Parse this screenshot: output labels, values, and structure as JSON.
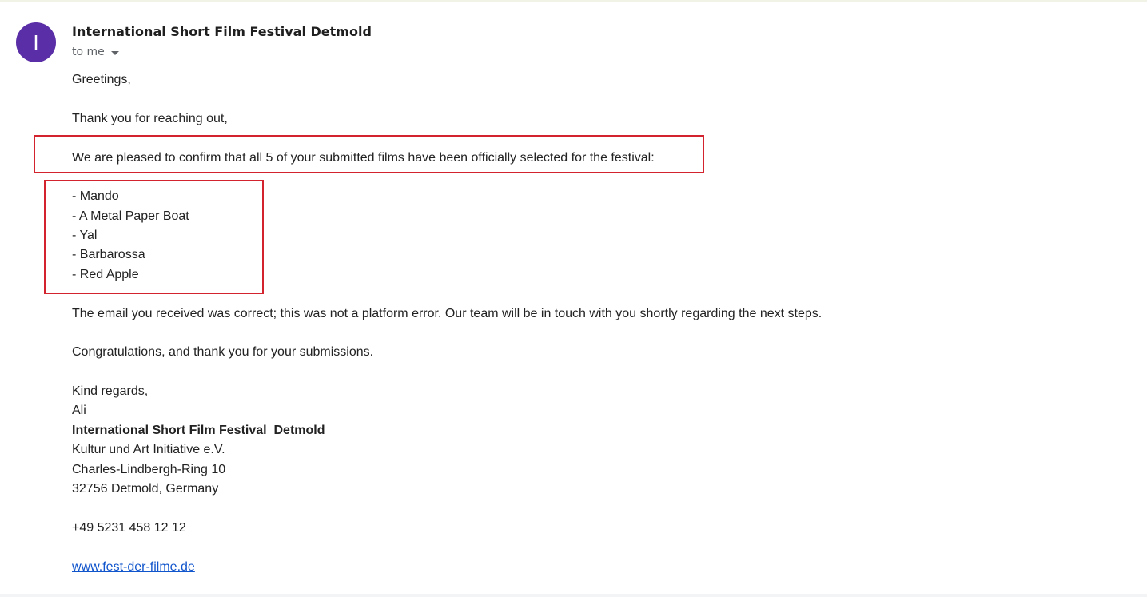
{
  "email": {
    "sender": {
      "avatar_initial": "I",
      "name": "International Short Film Festival Detmold",
      "recipient_label": "to me"
    },
    "body": {
      "greeting": "Greetings,",
      "thanks": "Thank you for reaching out,",
      "confirmation": "We are pleased to confirm that all 5 of your submitted films have been officially selected for the festival:",
      "films": [
        "- Mando",
        "- A Metal Paper Boat",
        "- Yal",
        "- Barbarossa",
        "- Red Apple"
      ],
      "clarification": "The email you received was correct; this was not a platform error. Our team will be in touch with you shortly regarding the next steps.",
      "congratulations": "Congratulations, and thank you for your submissions.",
      "closing": "Kind regards,",
      "signer": "Ali"
    },
    "signature": {
      "organization": "International Short Film Festival  Detmold",
      "association": "Kultur und Art Initiative e.V.",
      "street": "Charles-Lindbergh-Ring 10",
      "city": "32756 Detmold, Germany",
      "phone": "+49 5231 458 12 12",
      "website": "www.fest-der-filme.de"
    }
  },
  "colors": {
    "avatar_bg": "#5a2ea6",
    "highlight_border": "#d3232f",
    "link": "#1155cc"
  }
}
